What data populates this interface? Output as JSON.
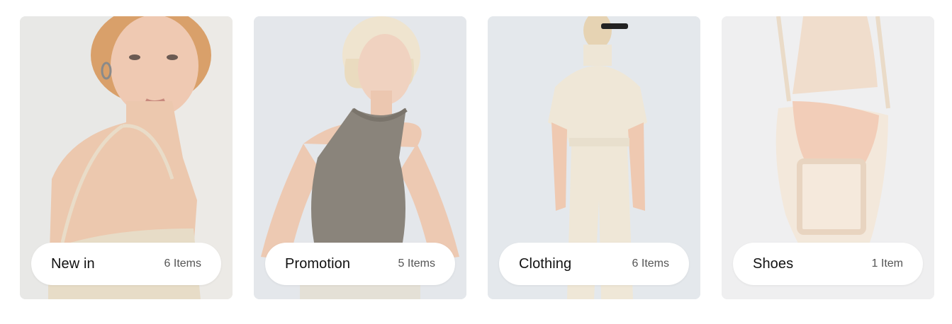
{
  "categories": [
    {
      "name": "New in",
      "count": "6 Items",
      "image": "model-in-beige-knit-top"
    },
    {
      "name": "Promotion",
      "count": "5 Items",
      "image": "model-in-grey-ribbed-tank"
    },
    {
      "name": "Clothing",
      "count": "6 Items",
      "image": "model-in-cream-jumpsuit-back"
    },
    {
      "name": "Shoes",
      "count": "1 Item",
      "image": "cream-studded-slingback-heel"
    }
  ],
  "colors": {
    "pill_background": "#ffffff",
    "label_text": "#111111",
    "count_text": "#555555",
    "card_background": "#e6e9ec"
  }
}
